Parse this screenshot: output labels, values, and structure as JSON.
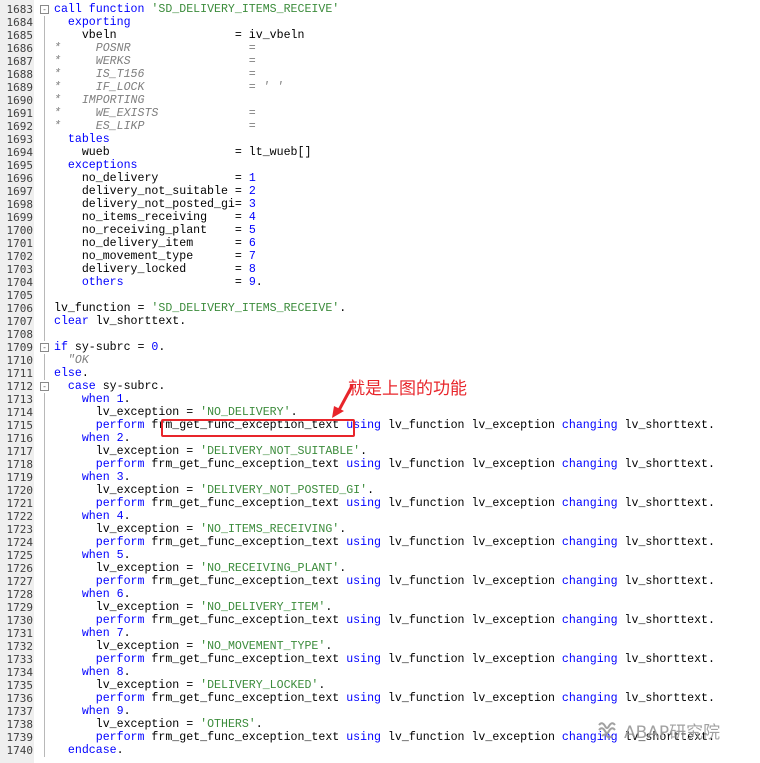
{
  "editor": {
    "lines": [
      {
        "ln": "1683",
        "fold": "-",
        "tokens": [
          {
            "c": "kw",
            "t": "call function "
          },
          {
            "c": "st",
            "t": "'SD_DELIVERY_ITEMS_RECEIVE'"
          }
        ]
      },
      {
        "ln": "1684",
        "fold": "",
        "tokens": [
          {
            "c": "kw",
            "t": "  exporting"
          }
        ]
      },
      {
        "ln": "1685",
        "fold": "",
        "tokens": [
          {
            "c": "tx",
            "t": "    vbeln                 = iv_vbeln"
          }
        ]
      },
      {
        "ln": "1686",
        "fold": "",
        "tokens": [
          {
            "c": "cm",
            "t": "*     POSNR                 ="
          }
        ]
      },
      {
        "ln": "1687",
        "fold": "",
        "tokens": [
          {
            "c": "cm",
            "t": "*     WERKS                 ="
          }
        ]
      },
      {
        "ln": "1688",
        "fold": "",
        "tokens": [
          {
            "c": "cm",
            "t": "*     IS_T156               ="
          }
        ]
      },
      {
        "ln": "1689",
        "fold": "",
        "tokens": [
          {
            "c": "cm",
            "t": "*     IF_LOCK               = ' '"
          }
        ]
      },
      {
        "ln": "1690",
        "fold": "",
        "tokens": [
          {
            "c": "cm",
            "t": "*   IMPORTING"
          }
        ]
      },
      {
        "ln": "1691",
        "fold": "",
        "tokens": [
          {
            "c": "cm",
            "t": "*     WE_EXISTS             ="
          }
        ]
      },
      {
        "ln": "1692",
        "fold": "",
        "tokens": [
          {
            "c": "cm",
            "t": "*     ES_LIKP               ="
          }
        ]
      },
      {
        "ln": "1693",
        "fold": "",
        "tokens": [
          {
            "c": "kw",
            "t": "  tables"
          }
        ]
      },
      {
        "ln": "1694",
        "fold": "",
        "tokens": [
          {
            "c": "tx",
            "t": "    wueb                  = lt_wueb[]"
          }
        ]
      },
      {
        "ln": "1695",
        "fold": "",
        "tokens": [
          {
            "c": "kw",
            "t": "  exceptions"
          }
        ]
      },
      {
        "ln": "1696",
        "fold": "",
        "tokens": [
          {
            "c": "tx",
            "t": "    no_delivery           = "
          },
          {
            "c": "nm",
            "t": "1"
          }
        ]
      },
      {
        "ln": "1697",
        "fold": "",
        "tokens": [
          {
            "c": "tx",
            "t": "    delivery_not_suitable = "
          },
          {
            "c": "nm",
            "t": "2"
          }
        ]
      },
      {
        "ln": "1698",
        "fold": "",
        "tokens": [
          {
            "c": "tx",
            "t": "    delivery_not_posted_gi= "
          },
          {
            "c": "nm",
            "t": "3"
          }
        ]
      },
      {
        "ln": "1699",
        "fold": "",
        "tokens": [
          {
            "c": "tx",
            "t": "    no_items_receiving    = "
          },
          {
            "c": "nm",
            "t": "4"
          }
        ]
      },
      {
        "ln": "1700",
        "fold": "",
        "tokens": [
          {
            "c": "tx",
            "t": "    no_receiving_plant    = "
          },
          {
            "c": "nm",
            "t": "5"
          }
        ]
      },
      {
        "ln": "1701",
        "fold": "",
        "tokens": [
          {
            "c": "tx",
            "t": "    no_delivery_item      = "
          },
          {
            "c": "nm",
            "t": "6"
          }
        ]
      },
      {
        "ln": "1702",
        "fold": "",
        "tokens": [
          {
            "c": "tx",
            "t": "    no_movement_type      = "
          },
          {
            "c": "nm",
            "t": "7"
          }
        ]
      },
      {
        "ln": "1703",
        "fold": "",
        "tokens": [
          {
            "c": "tx",
            "t": "    delivery_locked       = "
          },
          {
            "c": "nm",
            "t": "8"
          }
        ]
      },
      {
        "ln": "1704",
        "fold": "",
        "tokens": [
          {
            "c": "kw",
            "t": "    others                "
          },
          {
            "c": "tx",
            "t": "= "
          },
          {
            "c": "nm",
            "t": "9"
          },
          {
            "c": "tx",
            "t": "."
          }
        ]
      },
      {
        "ln": "1705",
        "fold": "",
        "tokens": []
      },
      {
        "ln": "1706",
        "fold": "",
        "tokens": [
          {
            "c": "tx",
            "t": "lv_function = "
          },
          {
            "c": "st",
            "t": "'SD_DELIVERY_ITEMS_RECEIVE'"
          },
          {
            "c": "tx",
            "t": "."
          }
        ]
      },
      {
        "ln": "1707",
        "fold": "",
        "tokens": [
          {
            "c": "kw",
            "t": "clear "
          },
          {
            "c": "tx",
            "t": "lv_shorttext."
          }
        ]
      },
      {
        "ln": "1708",
        "fold": "",
        "tokens": []
      },
      {
        "ln": "1709",
        "fold": "-",
        "tokens": [
          {
            "c": "kw",
            "t": "if "
          },
          {
            "c": "tx",
            "t": "sy-subrc = "
          },
          {
            "c": "nm",
            "t": "0"
          },
          {
            "c": "tx",
            "t": "."
          }
        ]
      },
      {
        "ln": "1710",
        "fold": "",
        "tokens": [
          {
            "c": "cm",
            "t": "  \"OK"
          }
        ]
      },
      {
        "ln": "1711",
        "fold": "",
        "tokens": [
          {
            "c": "kw",
            "t": "else"
          },
          {
            "c": "tx",
            "t": "."
          }
        ]
      },
      {
        "ln": "1712",
        "fold": "-",
        "tokens": [
          {
            "c": "kw",
            "t": "  case "
          },
          {
            "c": "tx",
            "t": "sy-subrc."
          }
        ]
      },
      {
        "ln": "1713",
        "fold": "",
        "tokens": [
          {
            "c": "kw",
            "t": "    when "
          },
          {
            "c": "nm",
            "t": "1"
          },
          {
            "c": "tx",
            "t": "."
          }
        ]
      },
      {
        "ln": "1714",
        "fold": "",
        "tokens": [
          {
            "c": "tx",
            "t": "      lv_exception = "
          },
          {
            "c": "st",
            "t": "'NO_DELIVERY'"
          },
          {
            "c": "tx",
            "t": "."
          }
        ]
      },
      {
        "ln": "1715",
        "fold": "",
        "tokens": [
          {
            "c": "kw",
            "t": "      perform "
          },
          {
            "c": "tx",
            "t": "frm_get_func_exception_text "
          },
          {
            "c": "kw",
            "t": "using "
          },
          {
            "c": "tx",
            "t": "lv_function lv_exception "
          },
          {
            "c": "kw",
            "t": "changing "
          },
          {
            "c": "tx",
            "t": "lv_shorttext."
          }
        ]
      },
      {
        "ln": "1716",
        "fold": "",
        "tokens": [
          {
            "c": "kw",
            "t": "    when "
          },
          {
            "c": "nm",
            "t": "2"
          },
          {
            "c": "tx",
            "t": "."
          }
        ]
      },
      {
        "ln": "1717",
        "fold": "",
        "tokens": [
          {
            "c": "tx",
            "t": "      lv_exception = "
          },
          {
            "c": "st",
            "t": "'DELIVERY_NOT_SUITABLE'"
          },
          {
            "c": "tx",
            "t": "."
          }
        ]
      },
      {
        "ln": "1718",
        "fold": "",
        "tokens": [
          {
            "c": "kw",
            "t": "      perform "
          },
          {
            "c": "tx",
            "t": "frm_get_func_exception_text "
          },
          {
            "c": "kw",
            "t": "using "
          },
          {
            "c": "tx",
            "t": "lv_function lv_exception "
          },
          {
            "c": "kw",
            "t": "changing "
          },
          {
            "c": "tx",
            "t": "lv_shorttext."
          }
        ]
      },
      {
        "ln": "1719",
        "fold": "",
        "tokens": [
          {
            "c": "kw",
            "t": "    when "
          },
          {
            "c": "nm",
            "t": "3"
          },
          {
            "c": "tx",
            "t": "."
          }
        ]
      },
      {
        "ln": "1720",
        "fold": "",
        "tokens": [
          {
            "c": "tx",
            "t": "      lv_exception = "
          },
          {
            "c": "st",
            "t": "'DELIVERY_NOT_POSTED_GI'"
          },
          {
            "c": "tx",
            "t": "."
          }
        ]
      },
      {
        "ln": "1721",
        "fold": "",
        "tokens": [
          {
            "c": "kw",
            "t": "      perform "
          },
          {
            "c": "tx",
            "t": "frm_get_func_exception_text "
          },
          {
            "c": "kw",
            "t": "using "
          },
          {
            "c": "tx",
            "t": "lv_function lv_exception "
          },
          {
            "c": "kw",
            "t": "changing "
          },
          {
            "c": "tx",
            "t": "lv_shorttext."
          }
        ]
      },
      {
        "ln": "1722",
        "fold": "",
        "tokens": [
          {
            "c": "kw",
            "t": "    when "
          },
          {
            "c": "nm",
            "t": "4"
          },
          {
            "c": "tx",
            "t": "."
          }
        ]
      },
      {
        "ln": "1723",
        "fold": "",
        "tokens": [
          {
            "c": "tx",
            "t": "      lv_exception = "
          },
          {
            "c": "st",
            "t": "'NO_ITEMS_RECEIVING'"
          },
          {
            "c": "tx",
            "t": "."
          }
        ]
      },
      {
        "ln": "1724",
        "fold": "",
        "tokens": [
          {
            "c": "kw",
            "t": "      perform "
          },
          {
            "c": "tx",
            "t": "frm_get_func_exception_text "
          },
          {
            "c": "kw",
            "t": "using "
          },
          {
            "c": "tx",
            "t": "lv_function lv_exception "
          },
          {
            "c": "kw",
            "t": "changing "
          },
          {
            "c": "tx",
            "t": "lv_shorttext."
          }
        ]
      },
      {
        "ln": "1725",
        "fold": "",
        "tokens": [
          {
            "c": "kw",
            "t": "    when "
          },
          {
            "c": "nm",
            "t": "5"
          },
          {
            "c": "tx",
            "t": "."
          }
        ]
      },
      {
        "ln": "1726",
        "fold": "",
        "tokens": [
          {
            "c": "tx",
            "t": "      lv_exception = "
          },
          {
            "c": "st",
            "t": "'NO_RECEIVING_PLANT'"
          },
          {
            "c": "tx",
            "t": "."
          }
        ]
      },
      {
        "ln": "1727",
        "fold": "",
        "tokens": [
          {
            "c": "kw",
            "t": "      perform "
          },
          {
            "c": "tx",
            "t": "frm_get_func_exception_text "
          },
          {
            "c": "kw",
            "t": "using "
          },
          {
            "c": "tx",
            "t": "lv_function lv_exception "
          },
          {
            "c": "kw",
            "t": "changing "
          },
          {
            "c": "tx",
            "t": "lv_shorttext."
          }
        ]
      },
      {
        "ln": "1728",
        "fold": "",
        "tokens": [
          {
            "c": "kw",
            "t": "    when "
          },
          {
            "c": "nm",
            "t": "6"
          },
          {
            "c": "tx",
            "t": "."
          }
        ]
      },
      {
        "ln": "1729",
        "fold": "",
        "tokens": [
          {
            "c": "tx",
            "t": "      lv_exception = "
          },
          {
            "c": "st",
            "t": "'NO_DELIVERY_ITEM'"
          },
          {
            "c": "tx",
            "t": "."
          }
        ]
      },
      {
        "ln": "1730",
        "fold": "",
        "tokens": [
          {
            "c": "kw",
            "t": "      perform "
          },
          {
            "c": "tx",
            "t": "frm_get_func_exception_text "
          },
          {
            "c": "kw",
            "t": "using "
          },
          {
            "c": "tx",
            "t": "lv_function lv_exception "
          },
          {
            "c": "kw",
            "t": "changing "
          },
          {
            "c": "tx",
            "t": "lv_shorttext."
          }
        ]
      },
      {
        "ln": "1731",
        "fold": "",
        "tokens": [
          {
            "c": "kw",
            "t": "    when "
          },
          {
            "c": "nm",
            "t": "7"
          },
          {
            "c": "tx",
            "t": "."
          }
        ]
      },
      {
        "ln": "1732",
        "fold": "",
        "tokens": [
          {
            "c": "tx",
            "t": "      lv_exception = "
          },
          {
            "c": "st",
            "t": "'NO_MOVEMENT_TYPE'"
          },
          {
            "c": "tx",
            "t": "."
          }
        ]
      },
      {
        "ln": "1733",
        "fold": "",
        "tokens": [
          {
            "c": "kw",
            "t": "      perform "
          },
          {
            "c": "tx",
            "t": "frm_get_func_exception_text "
          },
          {
            "c": "kw",
            "t": "using "
          },
          {
            "c": "tx",
            "t": "lv_function lv_exception "
          },
          {
            "c": "kw",
            "t": "changing "
          },
          {
            "c": "tx",
            "t": "lv_shorttext."
          }
        ]
      },
      {
        "ln": "1734",
        "fold": "",
        "tokens": [
          {
            "c": "kw",
            "t": "    when "
          },
          {
            "c": "nm",
            "t": "8"
          },
          {
            "c": "tx",
            "t": "."
          }
        ]
      },
      {
        "ln": "1735",
        "fold": "",
        "tokens": [
          {
            "c": "tx",
            "t": "      lv_exception = "
          },
          {
            "c": "st",
            "t": "'DELIVERY_LOCKED'"
          },
          {
            "c": "tx",
            "t": "."
          }
        ]
      },
      {
        "ln": "1736",
        "fold": "",
        "tokens": [
          {
            "c": "kw",
            "t": "      perform "
          },
          {
            "c": "tx",
            "t": "frm_get_func_exception_text "
          },
          {
            "c": "kw",
            "t": "using "
          },
          {
            "c": "tx",
            "t": "lv_function lv_exception "
          },
          {
            "c": "kw",
            "t": "changing "
          },
          {
            "c": "tx",
            "t": "lv_shorttext."
          }
        ]
      },
      {
        "ln": "1737",
        "fold": "",
        "tokens": [
          {
            "c": "kw",
            "t": "    when "
          },
          {
            "c": "nm",
            "t": "9"
          },
          {
            "c": "tx",
            "t": "."
          }
        ]
      },
      {
        "ln": "1738",
        "fold": "",
        "tokens": [
          {
            "c": "tx",
            "t": "      lv_exception = "
          },
          {
            "c": "st",
            "t": "'OTHERS'"
          },
          {
            "c": "tx",
            "t": "."
          }
        ]
      },
      {
        "ln": "1739",
        "fold": "",
        "tokens": [
          {
            "c": "kw",
            "t": "      perform "
          },
          {
            "c": "tx",
            "t": "frm_get_func_exception_text "
          },
          {
            "c": "kw",
            "t": "using "
          },
          {
            "c": "tx",
            "t": "lv_function lv_exception "
          },
          {
            "c": "kw",
            "t": "changing "
          },
          {
            "c": "tx",
            "t": "lv_shorttext."
          }
        ]
      },
      {
        "ln": "1740",
        "fold": "",
        "tokens": [
          {
            "c": "kw",
            "t": "  endcase"
          },
          {
            "c": "tx",
            "t": "."
          }
        ]
      }
    ]
  },
  "annotation": {
    "callout_text": "就是上图的功能",
    "color": "#e8252b"
  },
  "watermark": {
    "text": "ABAP研究院",
    "icon": "wechat-channel-icon"
  },
  "colors": {
    "keyword": "#0000ff",
    "string": "#3c8c3c",
    "comment": "#7f7f7f",
    "gutter": "#efefef"
  }
}
